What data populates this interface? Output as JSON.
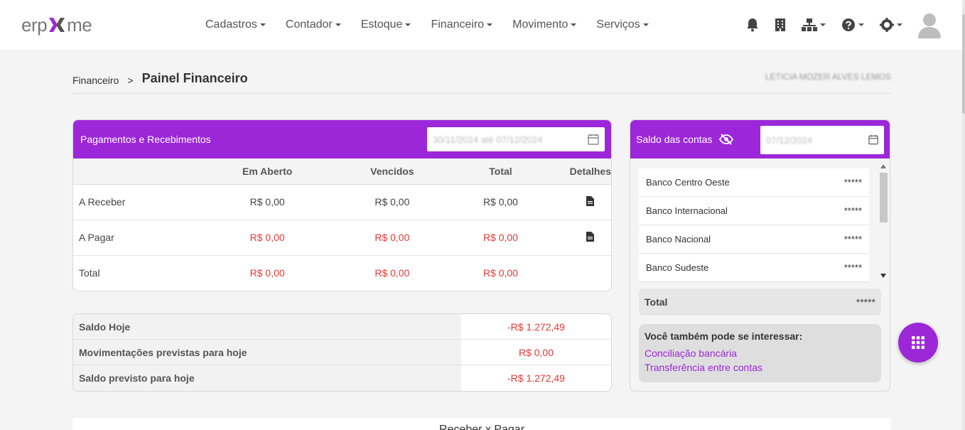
{
  "app": {
    "logo_left": "erp",
    "logo_right": "me"
  },
  "nav": {
    "items": [
      {
        "label": "Cadastros"
      },
      {
        "label": "Contador"
      },
      {
        "label": "Estoque"
      },
      {
        "label": "Financeiro"
      },
      {
        "label": "Movimento"
      },
      {
        "label": "Serviços"
      }
    ],
    "icons": [
      "bell-icon",
      "building-icon",
      "network-icon",
      "help-icon",
      "gear-icon",
      "avatar"
    ]
  },
  "breadcrumb": {
    "parent": "Financeiro",
    "separator": ">",
    "current": "Painel Financeiro",
    "user_name": "LETICIA MOZER ALVES LEMOS"
  },
  "payments": {
    "title": "Pagamentos e Recebimentos",
    "date_range": "30/11/2024 até 07/12/2024",
    "columns": [
      "",
      "Em Aberto",
      "Vencidos",
      "Total",
      "Detalhes"
    ],
    "rows": [
      {
        "label": "A Receber",
        "open": "R$ 0,00",
        "overdue": "R$ 0,00",
        "total": "R$ 0,00"
      },
      {
        "label": "A Pagar",
        "open": "R$ 0,00",
        "overdue": "R$ 0,00",
        "total": "R$ 0,00"
      },
      {
        "label": "Total",
        "open": "R$ 0,00",
        "overdue": "R$ 0,00",
        "total": "R$ 0,00"
      }
    ]
  },
  "balance": {
    "rows": [
      {
        "label": "Saldo Hoje",
        "value": "-R$ 1.272,49"
      },
      {
        "label": "Movimentações previstas para hoje",
        "value": "R$ 0,00"
      },
      {
        "label": "Saldo previsto para hoje",
        "value": "-R$ 1.272,49"
      }
    ]
  },
  "accounts": {
    "title": "Saldo das contas",
    "date": "07/12/2024",
    "items": [
      {
        "name": "Banco Centro Oeste",
        "value": "*****"
      },
      {
        "name": "Banco Internacional",
        "value": "*****"
      },
      {
        "name": "Banco Nacional",
        "value": "*****"
      },
      {
        "name": "Banco Sudeste",
        "value": "*****"
      }
    ],
    "total_label": "Total",
    "total_value": "*****",
    "interest_title": "Você também pode se interessar:",
    "links": [
      "Conciliação bancária",
      "Transferência entre contas"
    ]
  },
  "bottom": {
    "title": "Receber x Pagar"
  },
  "colors": {
    "accent": "#9c27d9",
    "negative": "#e53935"
  }
}
